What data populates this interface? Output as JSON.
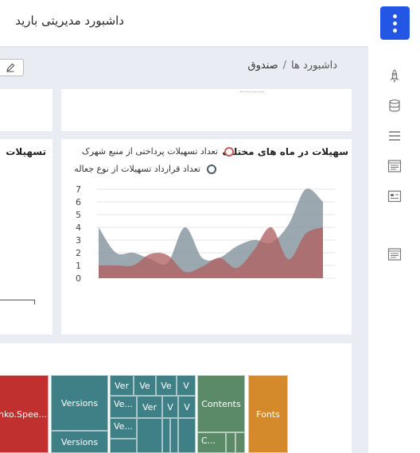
{
  "header": {
    "title": "داشبورد مدیریتی بارید",
    "menu_icon": "more-vertical-icon",
    "accent": "#2456e5"
  },
  "breadcrumb": {
    "home": "داشبورد ها",
    "separator": "/",
    "current": "صندوق"
  },
  "sidebar": {
    "icons": [
      "rocket-icon",
      "database-icon",
      "list-icon",
      "report-icon",
      "id-card-icon",
      "document-icon"
    ]
  },
  "cards": {
    "left_chart_title": "تسهیلات",
    "main_chart_title": "سهیلات در ماه های مختلف"
  },
  "chart_data": {
    "type": "area",
    "title": "سهیلات در ماه های مختلف",
    "ylim": [
      0,
      7
    ],
    "yticks": [
      "0",
      "1",
      "2",
      "3",
      "4",
      "5",
      "6",
      "7"
    ],
    "grid": true,
    "legend_position": "top-right",
    "series": [
      {
        "name": "تعداد تسهیلات پرداختی  از منبع شهرک",
        "color": "#c85a5a",
        "fill": "#b06060",
        "values": [
          1,
          1,
          1,
          1.9,
          1.8,
          0.5,
          0.9,
          1.6,
          0.8,
          2.2,
          4,
          1.5,
          3.5,
          4
        ]
      },
      {
        "name": "تعداد قرارداد تسهیلات از نوع جعاله",
        "color": "#4a5a66",
        "fill": "#7f909a",
        "values": [
          4,
          2,
          2,
          1.5,
          1.2,
          4,
          1.6,
          1.6,
          2.5,
          3,
          2.8,
          4.2,
          7,
          6
        ]
      }
    ]
  },
  "treemap": {
    "tiles": [
      {
        "label": "nko.Spee...",
        "color": "#c0302f"
      },
      {
        "label": "Versions",
        "color": "#3f7f86"
      },
      {
        "label": "Versions",
        "color": "#3f7f86"
      },
      {
        "label": "Ver",
        "color": "#3f7f86"
      },
      {
        "label": "Ve",
        "color": "#3f7f86"
      },
      {
        "label": "Ve",
        "color": "#3f7f86"
      },
      {
        "label": "V",
        "color": "#3f7f86"
      },
      {
        "label": "Ve...",
        "color": "#3f7f86"
      },
      {
        "label": "Ver",
        "color": "#3f7f86"
      },
      {
        "label": "V",
        "color": "#3f7f86"
      },
      {
        "label": "V",
        "color": "#3f7f86"
      },
      {
        "label": "Ve...",
        "color": "#3f7f86"
      },
      {
        "label": "Contents",
        "color": "#5a8a68"
      },
      {
        "label": "C...",
        "color": "#5a8a68"
      },
      {
        "label": "Fonts",
        "color": "#d4892b"
      }
    ]
  }
}
